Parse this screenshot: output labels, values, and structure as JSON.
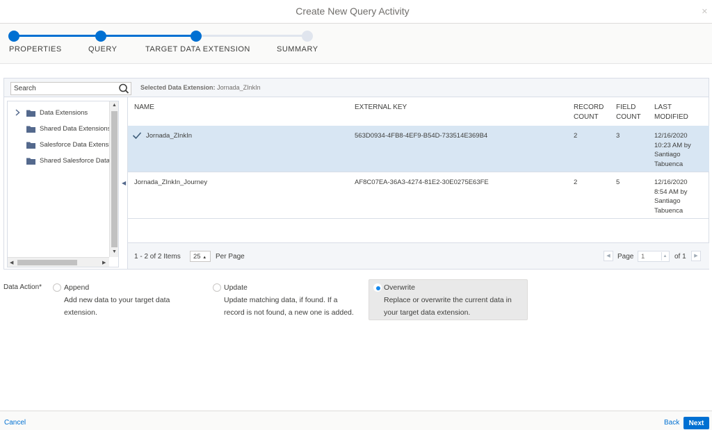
{
  "dialog": {
    "title": "Create New Query Activity"
  },
  "steps": [
    {
      "label": "PROPERTIES",
      "status": "complete"
    },
    {
      "label": "QUERY",
      "status": "complete"
    },
    {
      "label": "TARGET DATA EXTENSION",
      "status": "current"
    },
    {
      "label": "SUMMARY",
      "status": "incomplete"
    }
  ],
  "search": {
    "placeholder": "Search",
    "value": ""
  },
  "selected_de": {
    "label": "Selected Data Extension:",
    "value": "Jornada_ZInkIn"
  },
  "tree": {
    "items": [
      {
        "label": "Data Extensions",
        "expandable": true
      },
      {
        "label": "Shared Data Extensions",
        "expandable": false
      },
      {
        "label": "Salesforce Data Extensions",
        "expandable": false
      },
      {
        "label": "Shared Salesforce Data Extensions",
        "expandable": false
      }
    ]
  },
  "table": {
    "columns": [
      {
        "label": "NAME"
      },
      {
        "label": "EXTERNAL KEY"
      },
      {
        "label": "RECORD COUNT"
      },
      {
        "label": "FIELD COUNT"
      },
      {
        "label": "LAST MODIFIED"
      }
    ],
    "rows": [
      {
        "selected": true,
        "name": "Jornada_ZInkIn",
        "external_key": "563D0934-4FB8-4EF9-B54D-733514E369B4",
        "record_count": "2",
        "field_count": "3",
        "last_modified": "12/16/2020 10:23 AM by Santiago Tabuenca"
      },
      {
        "selected": false,
        "name": "Jornada_ZInkIn_Journey",
        "external_key": "AF8C07EA-36A3-4274-81E2-30E0275E63FE",
        "record_count": "2",
        "field_count": "5",
        "last_modified": "12/16/2020 8:54 AM by Santiago Tabuenca"
      }
    ]
  },
  "pagination": {
    "summary": "1 - 2 of 2 Items",
    "per_page_value": "25",
    "per_page_label": "Per Page",
    "page_label": "Page",
    "page_value": "1",
    "of_label": "of 1"
  },
  "data_action": {
    "label": "Data Action*",
    "options": [
      {
        "title": "Append",
        "desc_line1": "Add new data to your target data",
        "desc_line2": "extension.",
        "selected": false
      },
      {
        "title": "Update",
        "desc_line1": "Update matching data, if found. If a",
        "desc_line2": "record is not found, a new one is added.",
        "selected": false
      },
      {
        "title": "Overwrite",
        "desc_line1": "Replace or overwrite the current data in",
        "desc_line2": "your target data extension.",
        "selected": true
      }
    ]
  },
  "footer": {
    "cancel": "Cancel",
    "back": "Back",
    "next": "Next"
  },
  "colors": {
    "accent": "#0070d2",
    "selected_row": "#d8e6f3",
    "step_incomplete": "#e0e5ee"
  },
  "icons": [
    "close-icon",
    "search-icon",
    "chevron-right-icon",
    "folder-icon",
    "checkmark-icon",
    "collapse-arrow-icon"
  ]
}
